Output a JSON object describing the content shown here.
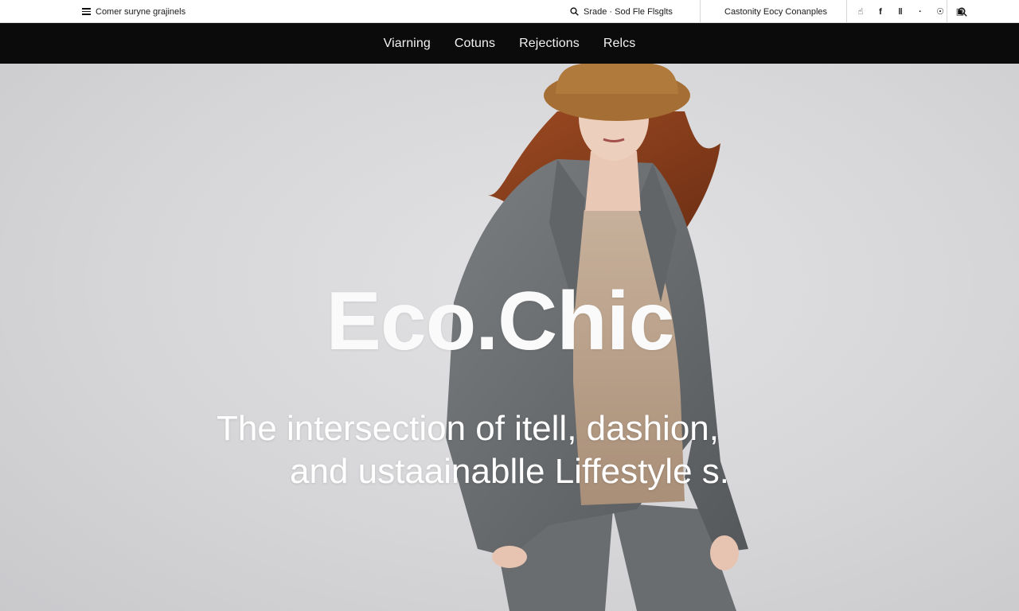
{
  "topbar": {
    "menu_label": "Comer suryne grajinels",
    "search_label": "Srade · Sod Fle Flsglts",
    "category_link": "Castonity Eocy Conanples",
    "socials": [
      {
        "icon": "thumb-icon",
        "glyph": "☝"
      },
      {
        "icon": "facebook-icon",
        "glyph": "f"
      },
      {
        "icon": "pause-icon",
        "glyph": "‖"
      },
      {
        "icon": "dot-icon",
        "glyph": "·"
      },
      {
        "icon": "pin-icon",
        "glyph": "☉"
      },
      {
        "icon": "instagram-icon",
        "glyph": "▣"
      }
    ]
  },
  "nav": {
    "items": [
      "Viarning",
      "Cotuns",
      "Rejections",
      "Relcs"
    ]
  },
  "hero": {
    "title": "Eco.Chic",
    "subtitle_line1": "The intersection of itell, dashion,",
    "subtitle_line2": "and ustaainablle Liffestyle s."
  },
  "colors": {
    "nav_bg": "#0b0b0b",
    "hero_bg": "#d6d6d8",
    "hat": "#b07a3c",
    "jacket": "#6f7274",
    "sweater": "#b9a08a",
    "hair": "#8a3f1e"
  }
}
